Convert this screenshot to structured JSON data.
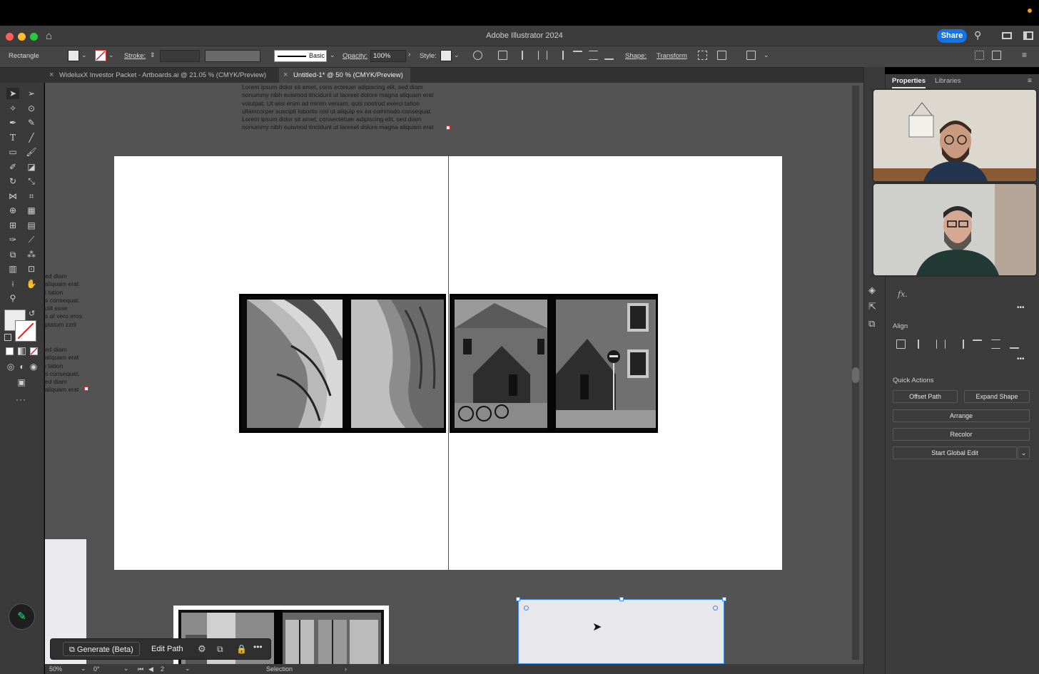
{
  "app": {
    "title": "Adobe Illustrator 2024",
    "share_label": "Share"
  },
  "control_bar": {
    "selection_label": "Rectangle",
    "stroke_label": "Stroke:",
    "brush_label": "Basic",
    "opacity_label": "Opacity:",
    "opacity_value": "100%",
    "style_label": "Style:",
    "shape_label": "Shape:",
    "transform_label": "Transform"
  },
  "tabs": [
    {
      "label": "WideluxX Investor Packet - Artboards.ai @ 21.05 % (CMYK/Preview)",
      "close": "×"
    },
    {
      "label": "Untitled-1* @ 50 % (CMYK/Preview)",
      "close": "×"
    }
  ],
  "canvas": {
    "top_text": [
      "Lorem ipsum dolor sit amet, cons ectetuer adipiscing elit, sed diam",
      "nonummy nibh euismod tincidunt ut laoreet dolore magna aliquam erat",
      "volutpat. Ut wisi enim ad minim veniam, quis nostrud exerci tation",
      "ullamcorper suscipit lobortis nisl ut aliquip ex ea commodo consequat.",
      "Lorem ipsum dolor sit amet, consectetuer adipiscing elit, sed diam",
      "nonummy nibh euismod tincidunt ut laoreet dolore magna aliquam erat"
    ],
    "side_text_1": [
      "ed diam",
      "aliquam erat",
      "i tation",
      "s consequat.",
      "olit esse",
      "s at vero eros",
      "ptatum zzril"
    ],
    "side_text_2": [
      "ed diam",
      "aliquam erat",
      "i tation",
      "s consequat.",
      "ed diam",
      "aliquam erat"
    ]
  },
  "context_bar": {
    "generate_label": "Generate (Beta)",
    "edit_path_label": "Edit Path",
    "more_label": "•••"
  },
  "status_bar": {
    "zoom": "50%",
    "rotation": "0°",
    "artboard_number": "2",
    "mode": "Selection"
  },
  "panel": {
    "tabs": [
      "Properties",
      "Libraries"
    ],
    "fx_label": "fx.",
    "align_title": "Align",
    "quick_actions_title": "Quick Actions",
    "buttons": {
      "offset_path": "Offset Path",
      "expand_shape": "Expand Shape",
      "arrange": "Arrange",
      "recolor": "Recolor",
      "start_global_edit": "Start Global Edit"
    },
    "more_label": "•••"
  },
  "video_call": {
    "participants": 2
  },
  "colors": {
    "accent": "#1473e6",
    "selection_blue": "#3b8ee8"
  }
}
